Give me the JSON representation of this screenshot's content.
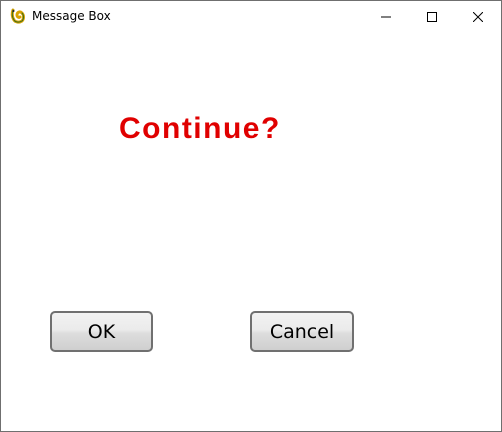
{
  "window": {
    "title": "Message Box",
    "app_icon": "pygame-snake-icon",
    "controls": {
      "minimize_icon": "minimize-icon",
      "maximize_icon": "maximize-icon",
      "close_icon": "close-icon"
    }
  },
  "dialog": {
    "message": "Continue?",
    "message_color": "#e00000",
    "ok_label": "OK",
    "cancel_label": "Cancel"
  }
}
